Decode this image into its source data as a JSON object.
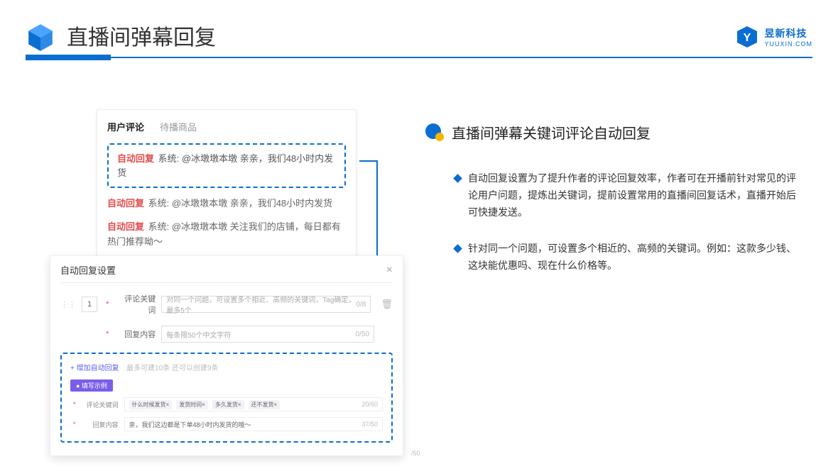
{
  "header": {
    "title": "直播间弹幕回复",
    "brand_name": "昱新科技",
    "brand_url": "YUUXIN.COM"
  },
  "comments_panel": {
    "tab_active": "用户评论",
    "tab_inactive": "待播商品",
    "msg1": "@冰墩墩本墩 亲亲，我们48小时内发货",
    "msg2": "@冰墩墩本墩 亲亲，我们48小时内发货",
    "msg3": "@冰墩墩本墩 关注我们的店铺，每日都有热门推荐呦～",
    "auto_reply_label": "自动回复",
    "system_label": "系统:"
  },
  "settings_panel": {
    "title": "自动回复设置",
    "index": "1",
    "row1_label": "评论关键词",
    "row1_placeholder": "对同一个问题，可设置多个相近、高频的关键词，Tag确定，最多5个",
    "row1_counter": "0/8",
    "row2_label": "回复内容",
    "row2_placeholder": "每条限50个中文字符",
    "row2_counter": "0/50",
    "add_link": "+ 增加自动回复",
    "add_note": "最多可建10条 还可以创建9条",
    "example_badge": "● 填写示例",
    "ex_row1_label": "评论关键词",
    "ex_tags": [
      "什么时候发货×",
      "发货时间×",
      "多久发货×",
      "还不发货×"
    ],
    "ex_row1_counter": "20/50",
    "ex_row2_label": "回复内容",
    "ex_row2_value": "亲，我们这边都是下单48小时内发货的哦～",
    "ex_row2_counter": "37/50",
    "outer_counter": "/50"
  },
  "right": {
    "title": "直播间弹幕关键词评论自动回复",
    "bullet1": "自动回复设置为了提升作者的评论回复效率，作者可在开播前针对常见的评论用户问题，提炼出关键词，提前设置常用的直播间回复话术，直播开始后可快捷发送。",
    "bullet2": "针对同一个问题，可设置多个相近的、高频的关键词。例如：这款多少钱、这块能优惠吗、现在什么价格等。"
  }
}
